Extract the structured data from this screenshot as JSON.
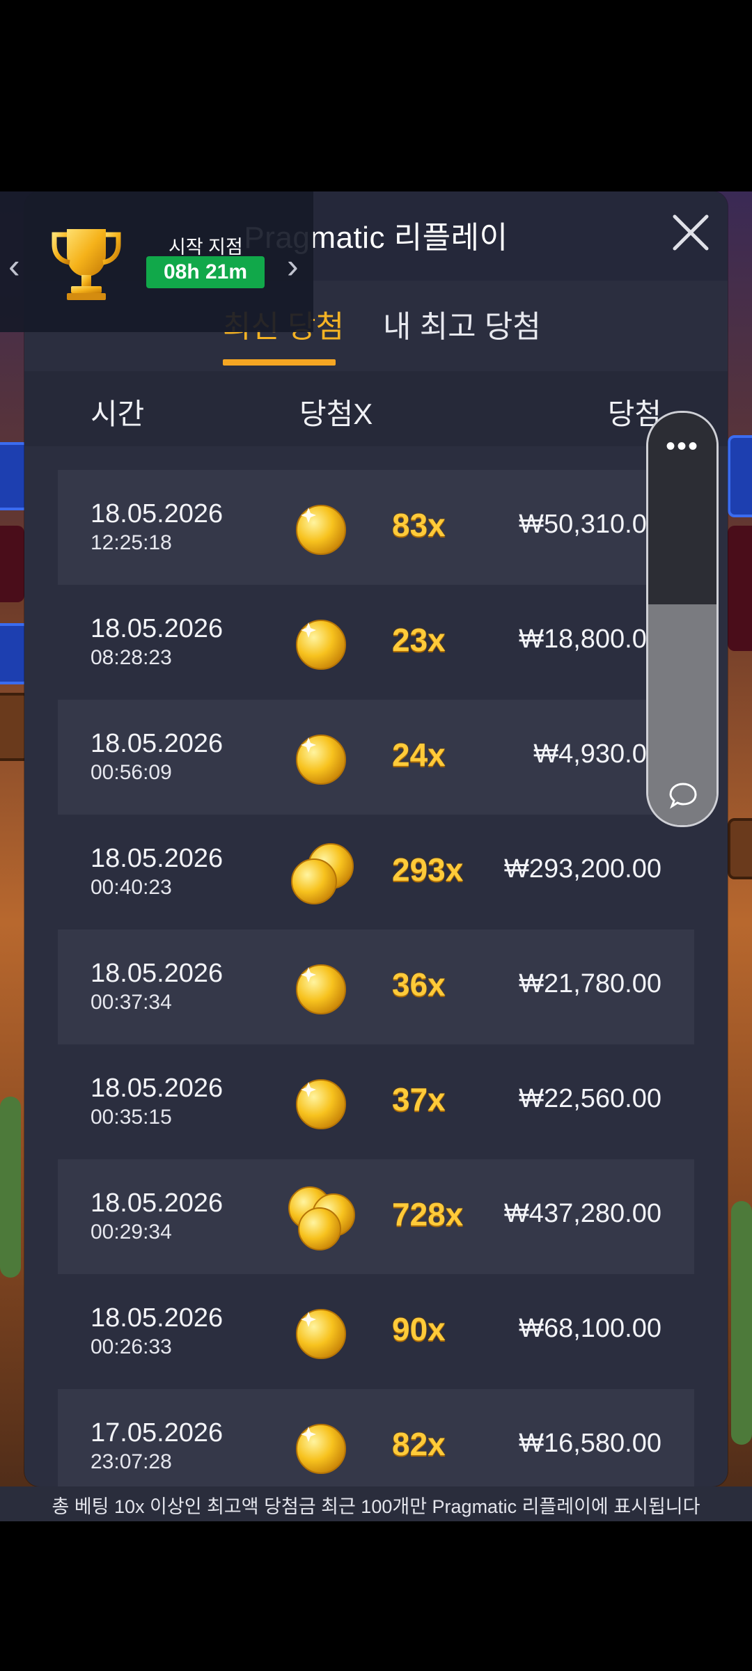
{
  "panel": {
    "title": "Pragmatic 리플레이",
    "close_icon": "close-icon"
  },
  "tabs": [
    {
      "label": "최신 당첨",
      "active": true
    },
    {
      "label": "내 최고 당첨",
      "active": false
    }
  ],
  "columns": {
    "time": "시간",
    "multiplier": "당첨X",
    "win": "당첨"
  },
  "rows": [
    {
      "date": "18.05.2026",
      "time": "12:25:18",
      "multiplier": "83x",
      "win": "₩50,310.00",
      "coins": "single"
    },
    {
      "date": "18.05.2026",
      "time": "08:28:23",
      "multiplier": "23x",
      "win": "₩18,800.00",
      "coins": "single"
    },
    {
      "date": "18.05.2026",
      "time": "00:56:09",
      "multiplier": "24x",
      "win": "₩4,930.00",
      "coins": "single"
    },
    {
      "date": "18.05.2026",
      "time": "00:40:23",
      "multiplier": "293x",
      "win": "₩293,200.00",
      "coins": "double"
    },
    {
      "date": "18.05.2026",
      "time": "00:37:34",
      "multiplier": "36x",
      "win": "₩21,780.00",
      "coins": "single"
    },
    {
      "date": "18.05.2026",
      "time": "00:35:15",
      "multiplier": "37x",
      "win": "₩22,560.00",
      "coins": "single"
    },
    {
      "date": "18.05.2026",
      "time": "00:29:34",
      "multiplier": "728x",
      "win": "₩437,280.00",
      "coins": "triple"
    },
    {
      "date": "18.05.2026",
      "time": "00:26:33",
      "multiplier": "90x",
      "win": "₩68,100.00",
      "coins": "single"
    },
    {
      "date": "17.05.2026",
      "time": "23:07:28",
      "multiplier": "82x",
      "win": "₩16,580.00",
      "coins": "single"
    }
  ],
  "tournament": {
    "start_label": "시작 지점",
    "timer": "08h 21m",
    "prev_arrow": "‹",
    "next_arrow": "›",
    "icon": "trophy-icon"
  },
  "floating_tool": {
    "dots": "•••",
    "icon": "chat-bubble-icon"
  },
  "footer": "총 베팅 10x 이상인 최고액 당첨금 최근 100개만 Pragmatic 리플레이에 표시됩니다",
  "colors": {
    "accent": "#f5a623",
    "multiplier": "#ffcb3a",
    "timer_bg": "#11a84a",
    "panel": "#2b2e3f"
  }
}
